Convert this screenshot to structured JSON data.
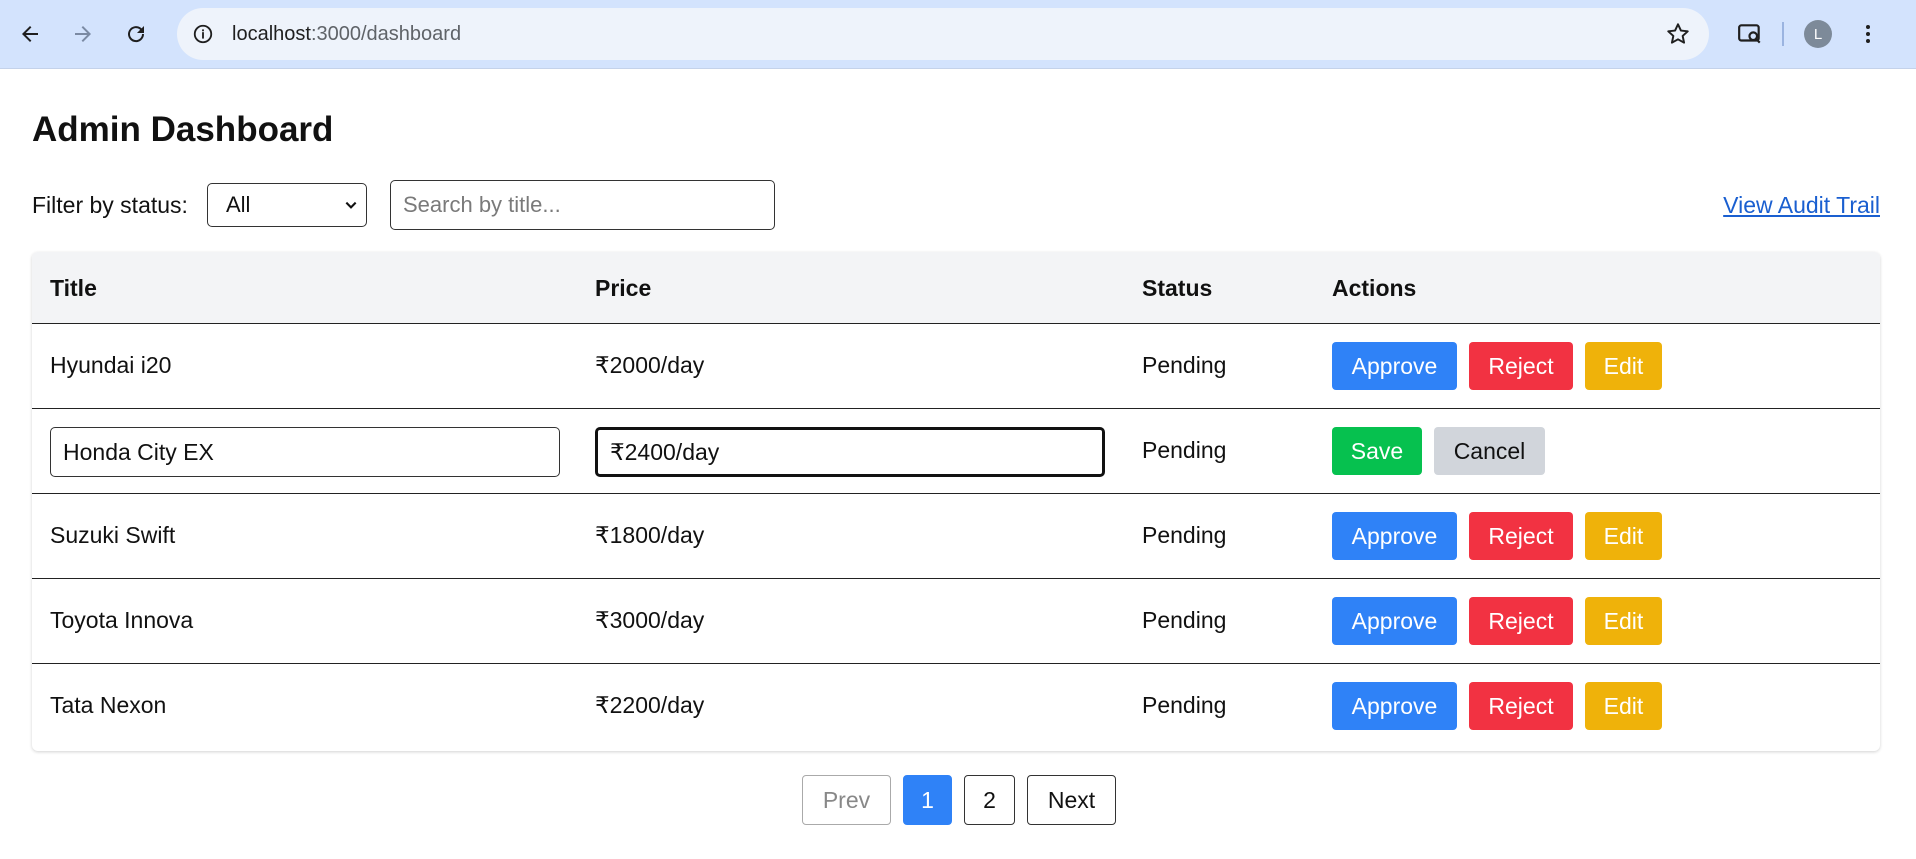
{
  "browser": {
    "url_host": "localhost",
    "url_path": ":3000/dashboard",
    "profile_initial": "L"
  },
  "page": {
    "title": "Admin Dashboard",
    "filter_label": "Filter by status:",
    "status_selected": "All",
    "search_placeholder": "Search by title...",
    "audit_link": "View Audit Trail"
  },
  "table": {
    "headers": {
      "title": "Title",
      "price": "Price",
      "status": "Status",
      "actions": "Actions"
    },
    "rows": [
      {
        "title": "Hyundai i20",
        "price": "₹2000/day",
        "status": "Pending"
      },
      {
        "title": "Honda City EX",
        "price": "₹2400/day",
        "status": "Pending",
        "editing": true
      },
      {
        "title": "Suzuki Swift",
        "price": "₹1800/day",
        "status": "Pending"
      },
      {
        "title": "Toyota Innova",
        "price": "₹3000/day",
        "status": "Pending"
      },
      {
        "title": "Tata Nexon",
        "price": "₹2200/day",
        "status": "Pending"
      }
    ],
    "actions": {
      "approve": "Approve",
      "reject": "Reject",
      "edit": "Edit",
      "save": "Save",
      "cancel": "Cancel"
    }
  },
  "pagination": {
    "prev": "Prev",
    "page1": "1",
    "page2": "2",
    "next": "Next",
    "current": 1
  },
  "colors": {
    "approve": "#2f82f7",
    "reject": "#f23242",
    "edit": "#efb20a",
    "save": "#06c14f",
    "cancel": "#d1d5db",
    "link": "#1a5fd0"
  }
}
